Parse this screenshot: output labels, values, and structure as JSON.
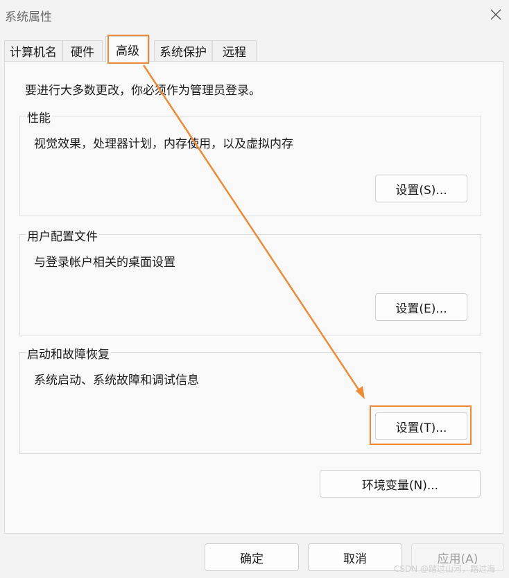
{
  "window": {
    "title": "系统属性",
    "close_icon": "close-icon"
  },
  "tabs": [
    {
      "label": "计算机名",
      "active": false
    },
    {
      "label": "硬件",
      "active": false
    },
    {
      "label": "高级",
      "active": true
    },
    {
      "label": "系统保护",
      "active": false
    },
    {
      "label": "远程",
      "active": false
    }
  ],
  "advanced": {
    "intro": "要进行大多数更改，你必须作为管理员登录。",
    "performance": {
      "title": "性能",
      "description": "视觉效果，处理器计划，内存使用，以及虚拟内存",
      "button": "设置(S)..."
    },
    "user_profiles": {
      "title": "用户配置文件",
      "description": "与登录帐户相关的桌面设置",
      "button": "设置(E)..."
    },
    "startup_recovery": {
      "title": "启动和故障恢复",
      "description": "系统启动、系统故障和调试信息",
      "button": "设置(T)..."
    },
    "env_vars_button": "环境变量(N)..."
  },
  "footer": {
    "ok": "确定",
    "cancel": "取消",
    "apply": "应用(A)"
  },
  "annotation_color": "#f08a35",
  "watermark": "CSDN @踏过山河，踏过海"
}
